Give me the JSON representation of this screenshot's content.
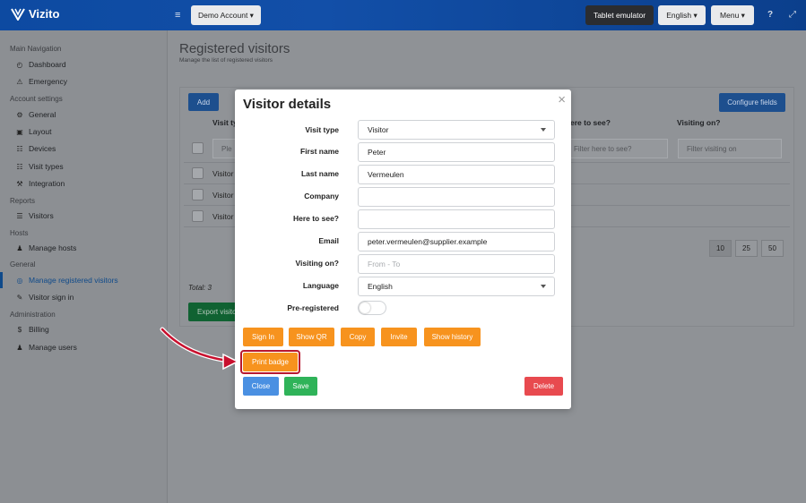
{
  "brand": {
    "name": "Vizito",
    "accent": "#0d4aa1"
  },
  "topbar": {
    "account": "Demo Account ▾",
    "tablet_emulator": "Tablet emulator",
    "language": "English ▾",
    "menu": "Menu ▾",
    "hamburger_icon": "≡",
    "help_icon": "?",
    "expand_icon": "⤢"
  },
  "sidebar": {
    "sections": [
      {
        "title": "Main Navigation",
        "items": [
          {
            "icon": "◴",
            "label": "Dashboard"
          },
          {
            "icon": "⚠",
            "label": "Emergency"
          }
        ]
      },
      {
        "title": "Account settings",
        "items": [
          {
            "icon": "⚙",
            "label": "General"
          },
          {
            "icon": "▣",
            "label": "Layout"
          },
          {
            "icon": "☷",
            "label": "Devices"
          },
          {
            "icon": "☷",
            "label": "Visit types"
          },
          {
            "icon": "⚒",
            "label": "Integration"
          }
        ]
      },
      {
        "title": "Reports",
        "items": [
          {
            "icon": "☰",
            "label": "Visitors"
          }
        ]
      },
      {
        "title": "Hosts",
        "items": [
          {
            "icon": "♟",
            "label": "Manage hosts"
          }
        ]
      },
      {
        "title": "General",
        "items": [
          {
            "icon": "◎",
            "label": "Manage registered visitors"
          },
          {
            "icon": "✎",
            "label": "Visitor sign in"
          }
        ]
      },
      {
        "title": "Administration",
        "items": [
          {
            "icon": "$",
            "label": "Billing"
          },
          {
            "icon": "♟",
            "label": "Manage users"
          }
        ]
      }
    ]
  },
  "page": {
    "title": "Registered visitors",
    "subtitle": "Manage the list of registered visitors",
    "add": "Add",
    "configure_fields": "Configure fields",
    "columns": {
      "visit_type": "Visit ty",
      "here_to_see": "ere to see?",
      "visiting_on": "Visiting on?"
    },
    "filters": {
      "first": "Ple",
      "here_to_see": "Filter here to see?",
      "visiting_on": "Filter visiting on"
    },
    "rows": [
      "Visitor",
      "Visitor",
      "Visitor"
    ],
    "pager": [
      "10",
      "25",
      "50"
    ],
    "total": "Total: 3",
    "export": "Export visito"
  },
  "modal": {
    "title": "Visitor details",
    "close_icon": "×",
    "fields": {
      "visit_type": {
        "label": "Visit type",
        "value": "Visitor"
      },
      "first_name": {
        "label": "First name",
        "value": "Peter"
      },
      "last_name": {
        "label": "Last name",
        "value": "Vermeulen"
      },
      "company": {
        "label": "Company",
        "value": ""
      },
      "here_to_see": {
        "label": "Here to see?",
        "value": ""
      },
      "email": {
        "label": "Email",
        "value": "peter.vermeulen@supplier.example"
      },
      "visiting_on": {
        "label": "Visiting on?",
        "placeholder": "From - To"
      },
      "language": {
        "label": "Language",
        "value": "English"
      },
      "pre_registered": {
        "label": "Pre-registered",
        "on": false
      }
    },
    "actions": {
      "sign_in": "Sign In",
      "show_qr": "Show QR",
      "copy": "Copy",
      "invite": "Invite",
      "show_history": "Show history",
      "print_badge": "Print badge",
      "close": "Close",
      "save": "Save",
      "delete": "Delete"
    }
  },
  "colors": {
    "orange": "#f7931e",
    "blue": "#4a90e2",
    "green": "#2fb359",
    "red": "#e84a4f",
    "highlight": "#b8182f"
  }
}
